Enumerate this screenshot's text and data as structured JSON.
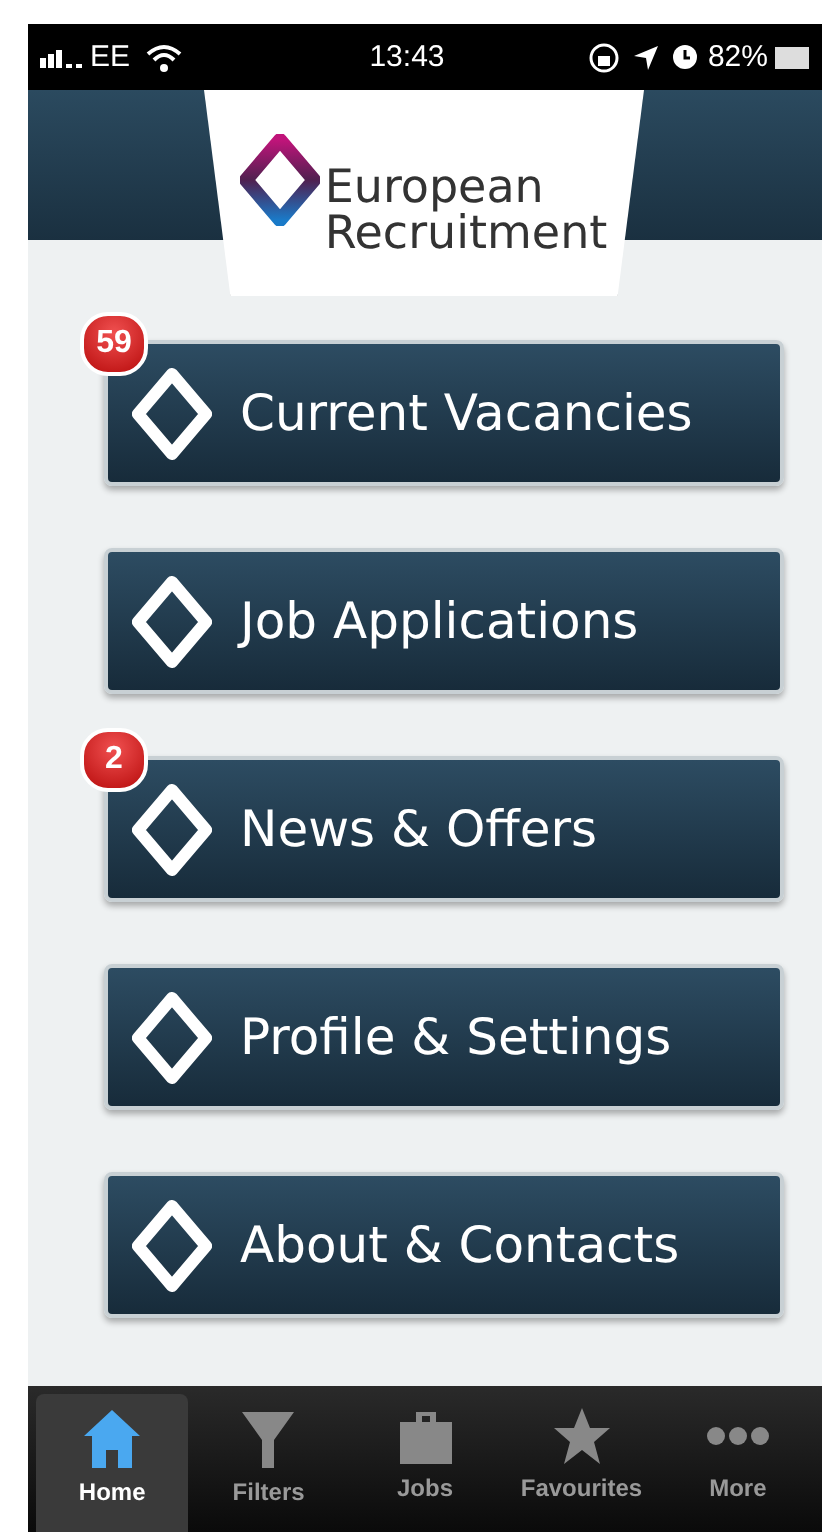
{
  "status_bar": {
    "carrier": "EE",
    "time": "13:43",
    "battery": "82%"
  },
  "logo": {
    "line_1": "European",
    "line_2": "Recruitment"
  },
  "menu": [
    {
      "label": "Current Vacancies",
      "badge": "59"
    },
    {
      "label": "Job Applications"
    },
    {
      "label": "News & Offers",
      "badge": "2"
    },
    {
      "label": "Profile & Settings"
    },
    {
      "label": "About & Contacts"
    }
  ],
  "tab_bar": [
    {
      "label": "Home",
      "kind": "home",
      "selected": true
    },
    {
      "label": "Filters",
      "kind": "filter",
      "selected": false
    },
    {
      "label": "Jobs",
      "kind": "briefcase",
      "selected": false
    },
    {
      "label": "Favourites",
      "kind": "star",
      "selected": false
    },
    {
      "label": "More",
      "kind": "more",
      "selected": false
    }
  ]
}
